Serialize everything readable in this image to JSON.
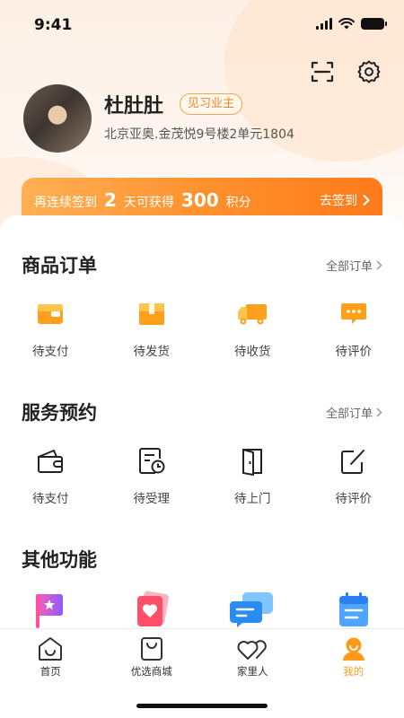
{
  "status_bar": {
    "time": "9:41"
  },
  "profile": {
    "name": "杜肚肚",
    "tag": "见习业主",
    "address": "北京亚奥.金茂悦9号楼2单元1804"
  },
  "sign_banner": {
    "prefix": "再连续签到",
    "days": "2",
    "middle": "天可获得",
    "points": "300",
    "suffix": "积分",
    "action": "去签到"
  },
  "orders": {
    "title": "商品订单",
    "more": "全部订单",
    "items": [
      {
        "label": "待支付",
        "icon": "wallet-icon"
      },
      {
        "label": "待发货",
        "icon": "package-icon"
      },
      {
        "label": "待收货",
        "icon": "truck-icon"
      },
      {
        "label": "待评价",
        "icon": "comment-icon"
      }
    ]
  },
  "services": {
    "title": "服务预约",
    "more": "全部订单",
    "items": [
      {
        "label": "待支付",
        "icon": "wallet-outline-icon"
      },
      {
        "label": "待受理",
        "icon": "clock-document-icon"
      },
      {
        "label": "待上门",
        "icon": "door-icon"
      },
      {
        "label": "待评价",
        "icon": "edit-icon"
      }
    ]
  },
  "other": {
    "title": "其他功能",
    "items": [
      {
        "icon": "flag-star-icon"
      },
      {
        "icon": "heart-card-icon"
      },
      {
        "icon": "chat-bubbles-icon"
      },
      {
        "icon": "calendar-list-icon"
      }
    ]
  },
  "tabbar": {
    "items": [
      {
        "label": "首页",
        "icon": "home-icon"
      },
      {
        "label": "优选商城",
        "icon": "shopping-bag-icon"
      },
      {
        "label": "家里人",
        "icon": "hearts-icon"
      },
      {
        "label": "我的",
        "icon": "profile-icon"
      }
    ],
    "active": 3
  },
  "colors": {
    "accent": "#ff9a1a",
    "banner_start": "#ffb055",
    "banner_end": "#ff7a1a",
    "tag_border": "#f3a64a"
  }
}
